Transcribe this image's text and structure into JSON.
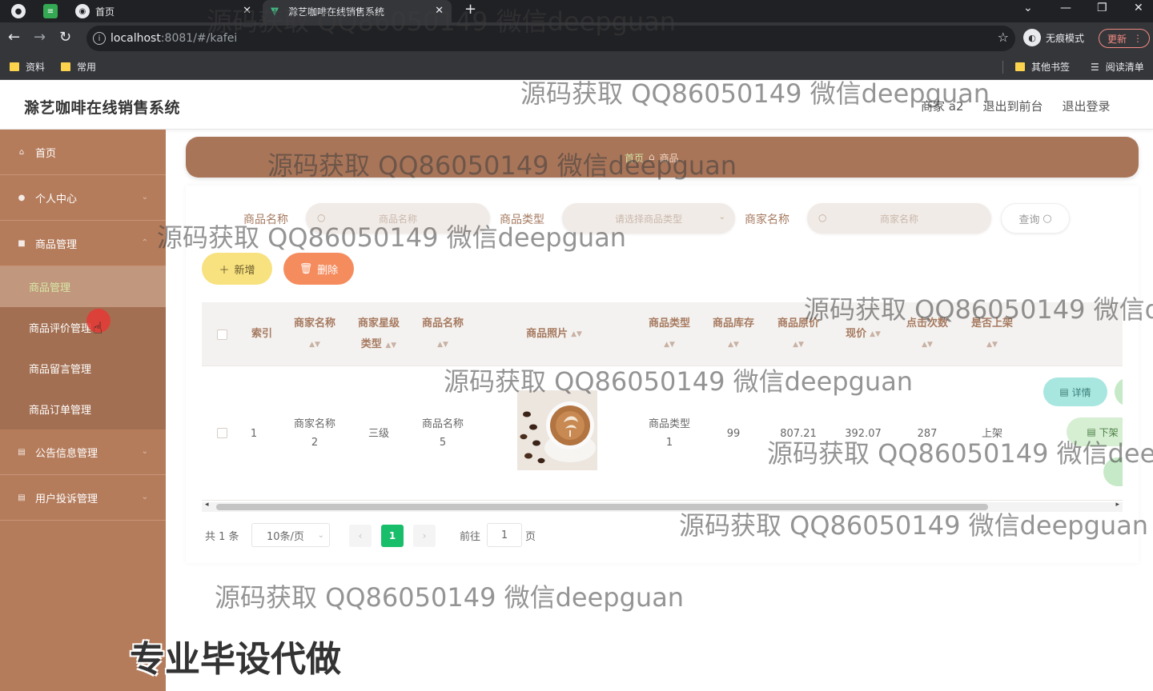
{
  "browser": {
    "tabs": [
      {
        "label": "首页"
      },
      {
        "label": "滁艺咖啡在线销售系统"
      }
    ],
    "url_host": "localhost",
    "url_rest": ":8081/#/kafei",
    "incognito_label": "无痕模式",
    "update_label": "更新",
    "bookmarks": [
      "资料",
      "常用"
    ],
    "bookmarks_right": [
      "其他书签",
      "阅读清单"
    ]
  },
  "header": {
    "title": "滁艺咖啡在线销售系统",
    "user": "商家 a2",
    "to_front": "退出到前台",
    "logout": "退出登录"
  },
  "sidebar": {
    "items": [
      {
        "label": "首页",
        "icon": "home-icon"
      },
      {
        "label": "个人中心",
        "icon": "user-icon"
      },
      {
        "label": "商品管理",
        "icon": "goods-icon"
      },
      {
        "label": "公告信息管理",
        "icon": "notice-icon"
      },
      {
        "label": "用户投诉管理",
        "icon": "complaint-icon"
      }
    ],
    "sub_items": [
      "商品管理",
      "商品评价管理",
      "商品留言管理",
      "商品订单管理"
    ]
  },
  "breadcrumb": {
    "home": "首页",
    "current": "商品"
  },
  "search": {
    "name_label": "商品名称",
    "name_placeholder": "商品名称",
    "type_label": "商品类型",
    "type_placeholder": "请选择商品类型",
    "merchant_label": "商家名称",
    "merchant_placeholder": "商家名称",
    "query": "查询"
  },
  "actions": {
    "add": "新增",
    "delete": "删除"
  },
  "table": {
    "headers": {
      "index": "索引",
      "merchant_name": [
        "商家名称"
      ],
      "merchant_level": [
        "商家星级",
        "类型"
      ],
      "goods_name": [
        "商品名称"
      ],
      "photo": "商品照片",
      "goods_type": [
        "商品类型"
      ],
      "stock": [
        "商品库存"
      ],
      "original_price": [
        "商品原价"
      ],
      "price": "现价",
      "clicks": [
        "点击次数"
      ],
      "on_shelf": [
        "是否上架"
      ]
    },
    "rows": [
      {
        "index": "1",
        "merchant_name": [
          "商家名称",
          "2"
        ],
        "merchant_level": "三级",
        "goods_name": [
          "商品名称",
          "5"
        ],
        "goods_type": [
          "商品类型",
          "1"
        ],
        "stock": "99",
        "original_price": "807.21",
        "price": "392.07",
        "clicks": "287",
        "on_shelf": "上架",
        "detail": "详情",
        "off_shelf": "下架"
      }
    ]
  },
  "pagination": {
    "total": "共 1 条",
    "page_size": "10条/页",
    "current": "1",
    "goto": "前往",
    "goto_value": "1",
    "page_unit": "页"
  },
  "watermark": "源码获取 QQ86050149 微信deepguan",
  "promo": "专业毕设代做",
  "colors": {
    "sidebar": "#b57c5c",
    "breadcrumb": "#a97559",
    "add": "#f7e27f",
    "delete": "#f58c5e",
    "active_page": "#19be6b",
    "detail": "#a8e6e0"
  }
}
